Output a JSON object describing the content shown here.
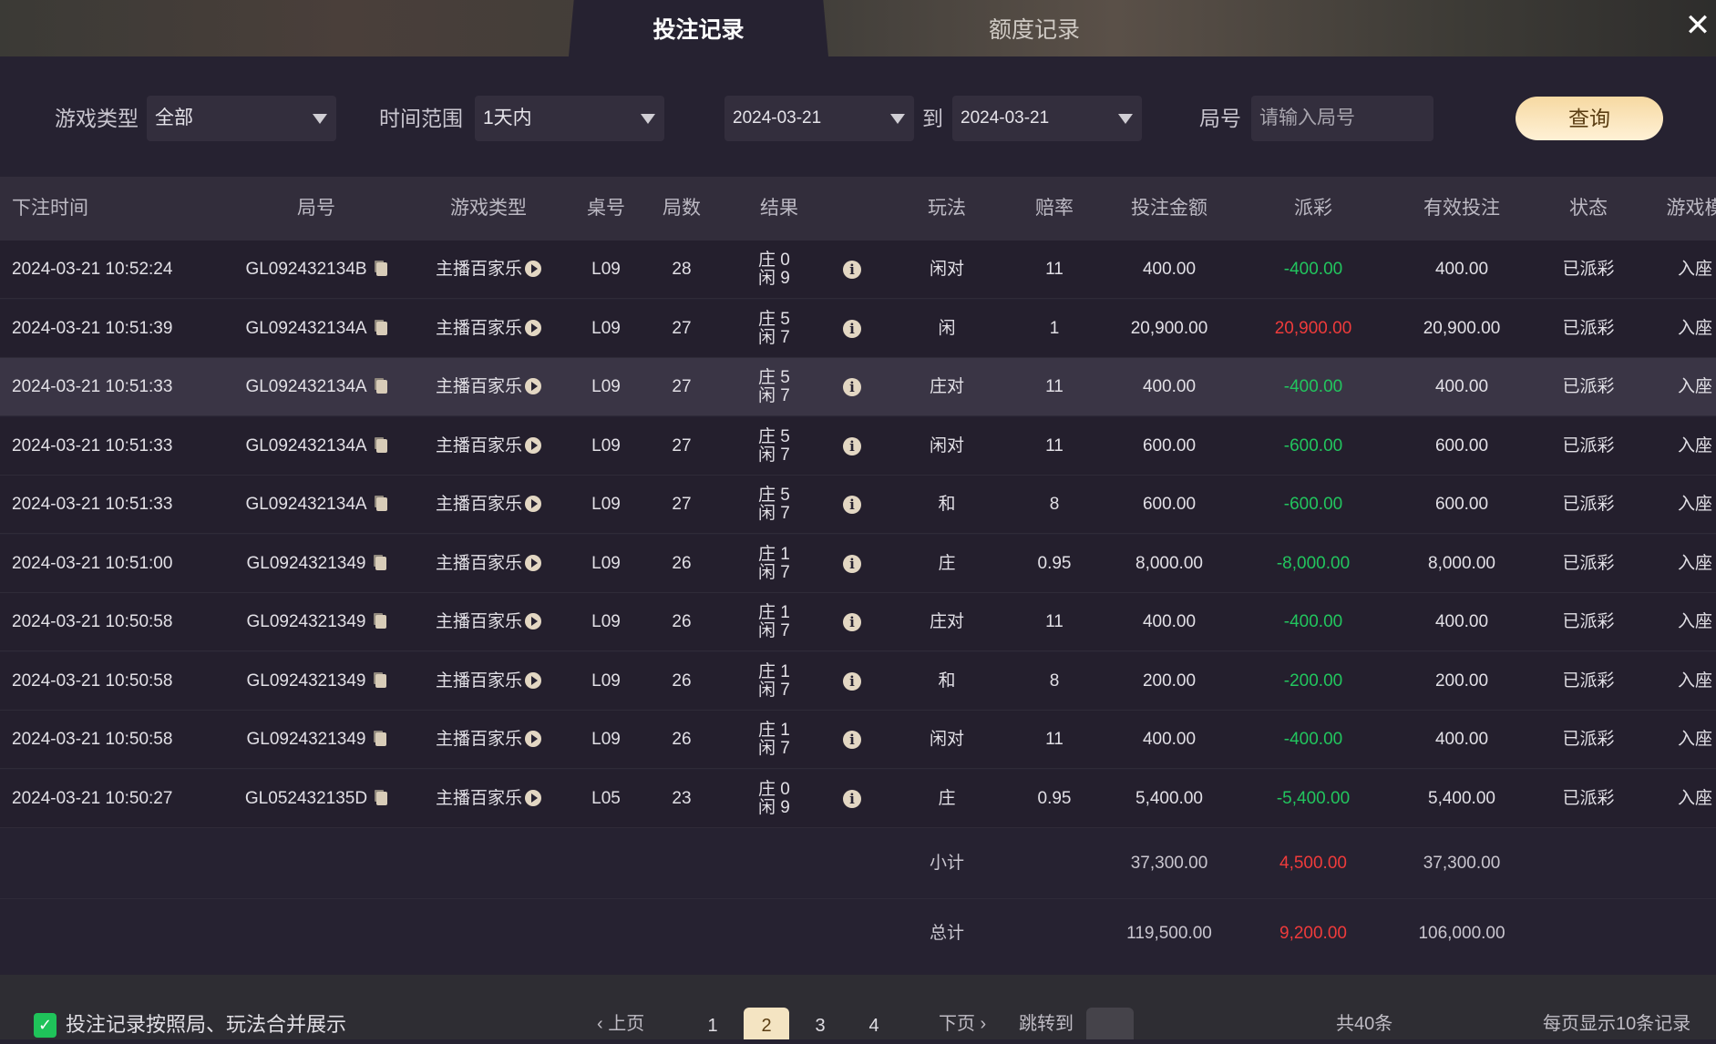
{
  "tabs": [
    {
      "label": "投注记录",
      "active": true
    },
    {
      "label": "额度记录",
      "active": false
    }
  ],
  "filters": {
    "game_type_label": "游戏类型",
    "game_type_value": "全部",
    "time_range_label": "时间范围",
    "time_range_value": "1天内",
    "date_from": "2024-03-21",
    "date_to_label": "到",
    "date_to": "2024-03-21",
    "round_label": "局号",
    "round_placeholder": "请输入局号",
    "query_button": "查询"
  },
  "columns": [
    "下注时间",
    "局号",
    "游戏类型",
    "桌号",
    "局数",
    "结果",
    "玩法",
    "赔率",
    "投注金额",
    "派彩",
    "有效投注",
    "状态",
    "游戏模"
  ],
  "rows": [
    {
      "time": "2024-03-21 10:52:24",
      "round": "GL092432134B",
      "game": "主播百家乐",
      "table": "L09",
      "num": "28",
      "banker": "庄 0",
      "player": "闲 9",
      "bet": "闲对",
      "odds": "11",
      "amount": "400.00",
      "payout": "-400.00",
      "valid": "400.00",
      "status": "已派彩",
      "mode": "入座"
    },
    {
      "time": "2024-03-21 10:51:39",
      "round": "GL092432134A",
      "game": "主播百家乐",
      "table": "L09",
      "num": "27",
      "banker": "庄 5",
      "player": "闲 7",
      "bet": "闲",
      "odds": "1",
      "amount": "20,900.00",
      "payout": "20,900.00",
      "valid": "20,900.00",
      "status": "已派彩",
      "mode": "入座"
    },
    {
      "time": "2024-03-21 10:51:33",
      "round": "GL092432134A",
      "game": "主播百家乐",
      "table": "L09",
      "num": "27",
      "banker": "庄 5",
      "player": "闲 7",
      "bet": "庄对",
      "odds": "11",
      "amount": "400.00",
      "payout": "-400.00",
      "valid": "400.00",
      "status": "已派彩",
      "mode": "入座"
    },
    {
      "time": "2024-03-21 10:51:33",
      "round": "GL092432134A",
      "game": "主播百家乐",
      "table": "L09",
      "num": "27",
      "banker": "庄 5",
      "player": "闲 7",
      "bet": "闲对",
      "odds": "11",
      "amount": "600.00",
      "payout": "-600.00",
      "valid": "600.00",
      "status": "已派彩",
      "mode": "入座"
    },
    {
      "time": "2024-03-21 10:51:33",
      "round": "GL092432134A",
      "game": "主播百家乐",
      "table": "L09",
      "num": "27",
      "banker": "庄 5",
      "player": "闲 7",
      "bet": "和",
      "odds": "8",
      "amount": "600.00",
      "payout": "-600.00",
      "valid": "600.00",
      "status": "已派彩",
      "mode": "入座"
    },
    {
      "time": "2024-03-21 10:51:00",
      "round": "GL0924321349",
      "game": "主播百家乐",
      "table": "L09",
      "num": "26",
      "banker": "庄 1",
      "player": "闲 7",
      "bet": "庄",
      "odds": "0.95",
      "amount": "8,000.00",
      "payout": "-8,000.00",
      "valid": "8,000.00",
      "status": "已派彩",
      "mode": "入座"
    },
    {
      "time": "2024-03-21 10:50:58",
      "round": "GL0924321349",
      "game": "主播百家乐",
      "table": "L09",
      "num": "26",
      "banker": "庄 1",
      "player": "闲 7",
      "bet": "庄对",
      "odds": "11",
      "amount": "400.00",
      "payout": "-400.00",
      "valid": "400.00",
      "status": "已派彩",
      "mode": "入座"
    },
    {
      "time": "2024-03-21 10:50:58",
      "round": "GL0924321349",
      "game": "主播百家乐",
      "table": "L09",
      "num": "26",
      "banker": "庄 1",
      "player": "闲 7",
      "bet": "和",
      "odds": "8",
      "amount": "200.00",
      "payout": "-200.00",
      "valid": "200.00",
      "status": "已派彩",
      "mode": "入座"
    },
    {
      "time": "2024-03-21 10:50:58",
      "round": "GL0924321349",
      "game": "主播百家乐",
      "table": "L09",
      "num": "26",
      "banker": "庄 1",
      "player": "闲 7",
      "bet": "闲对",
      "odds": "11",
      "amount": "400.00",
      "payout": "-400.00",
      "valid": "400.00",
      "status": "已派彩",
      "mode": "入座"
    },
    {
      "time": "2024-03-21 10:50:27",
      "round": "GL052432135D",
      "game": "主播百家乐",
      "table": "L05",
      "num": "23",
      "banker": "庄 0",
      "player": "闲 9",
      "bet": "庄",
      "odds": "0.95",
      "amount": "5,400.00",
      "payout": "-5,400.00",
      "valid": "5,400.00",
      "status": "已派彩",
      "mode": "入座"
    }
  ],
  "subtotal": {
    "label": "小计",
    "amount": "37,300.00",
    "payout": "4,500.00",
    "valid": "37,300.00"
  },
  "total": {
    "label": "总计",
    "amount": "119,500.00",
    "payout": "9,200.00",
    "valid": "106,000.00"
  },
  "footer": {
    "merge_label": "投注记录按照局、玩法合并展示",
    "merge_checked": true,
    "prev": "上页",
    "next": "下页",
    "pages": [
      "1",
      "2",
      "3",
      "4"
    ],
    "current_page": "2",
    "jump_label": "跳转到",
    "total_count": "共40条",
    "per_page": "每页显示10条记录"
  },
  "colors": {
    "negative": "#22c55e",
    "positive": "#ef3b3b",
    "accent": "#f6d9a2"
  }
}
